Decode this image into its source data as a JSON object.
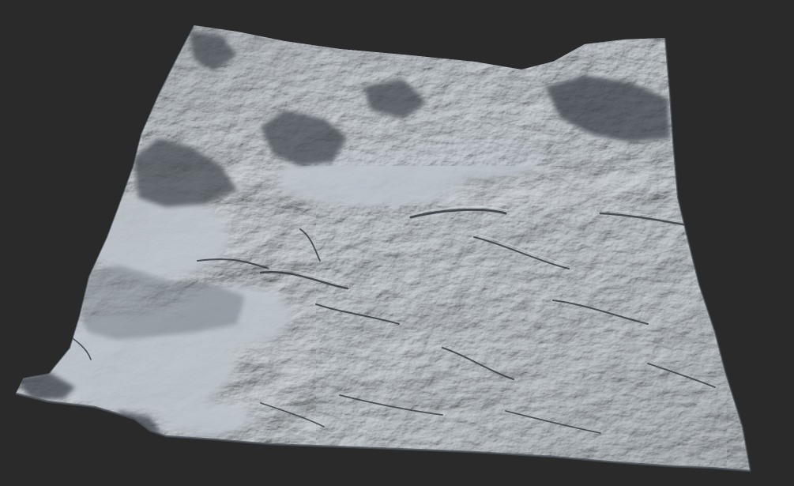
{
  "viewport": {
    "background_color": "#2a2a2a",
    "content": "heightmap-terrain-mesh"
  },
  "terrain": {
    "base_color": "#9ea5ad",
    "highlight_color": "#d4dade",
    "shadow_color": "#2d3238",
    "ridge_color": "#43494f"
  }
}
